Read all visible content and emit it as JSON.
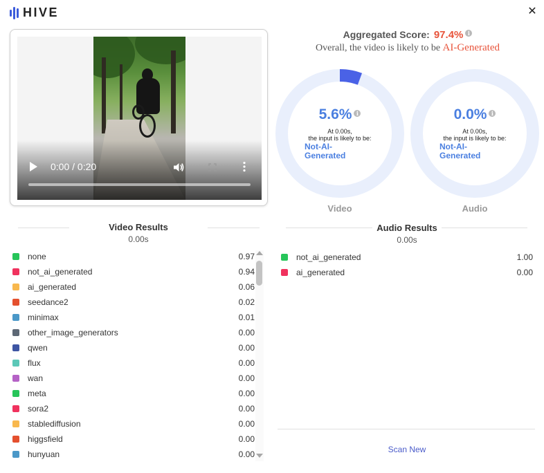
{
  "app": {
    "logo_text": "HIVE",
    "brand_color": "#3b5bdb",
    "icons": {
      "close": "close-icon",
      "info": "info-icon"
    }
  },
  "video_player": {
    "time": "0:00 / 0:20",
    "progress": 0.0,
    "icons": {
      "play": "play-icon",
      "volume": "volume-icon",
      "fullscreen": "fullscreen-icon",
      "more": "more-vert-icon"
    }
  },
  "aggregate": {
    "label": "Aggregated Score:",
    "score": "97.4%",
    "summary_prefix": "Overall, the video is likely to be",
    "verdict": "AI-Generated",
    "verdict_color": "#e8543b",
    "info_glyph": "i"
  },
  "rings": [
    {
      "key": "video",
      "value_text": "5.6%",
      "fraction": 0.056,
      "time_line": "At 0.00s,",
      "likely_line": "the input is likely to be:",
      "verdict_line1": "Not-AI-",
      "verdict_line2": "Generated",
      "caption": "Video",
      "info_glyph": "i"
    },
    {
      "key": "audio",
      "value_text": "0.0%",
      "fraction": 0.0,
      "time_line": "At 0.00s,",
      "likely_line": "the input is likely to be:",
      "verdict_line1": "Not-AI-",
      "verdict_line2": "Generated",
      "caption": "Audio",
      "info_glyph": "i"
    }
  ],
  "ring_colors": {
    "track": "#e9effc",
    "fill": "#4a62e6",
    "text": "#4a7fe0"
  },
  "video_results": {
    "title": "Video Results",
    "time": "0.00s",
    "items": [
      {
        "name": "none",
        "value": "0.97",
        "color": "#27c55a"
      },
      {
        "name": "not_ai_generated",
        "value": "0.94",
        "color": "#f0325e"
      },
      {
        "name": "ai_generated",
        "value": "0.06",
        "color": "#f8b84e"
      },
      {
        "name": "seedance2",
        "value": "0.02",
        "color": "#e4502e"
      },
      {
        "name": "minimax",
        "value": "0.01",
        "color": "#4b98c8"
      },
      {
        "name": "other_image_generators",
        "value": "0.00",
        "color": "#5d6875"
      },
      {
        "name": "qwen",
        "value": "0.00",
        "color": "#3e55a3"
      },
      {
        "name": "flux",
        "value": "0.00",
        "color": "#5cc8b8"
      },
      {
        "name": "wan",
        "value": "0.00",
        "color": "#b562c6"
      },
      {
        "name": "meta",
        "value": "0.00",
        "color": "#27c55a"
      },
      {
        "name": "sora2",
        "value": "0.00",
        "color": "#f0325e"
      },
      {
        "name": "stablediffusion",
        "value": "0.00",
        "color": "#f8b84e"
      },
      {
        "name": "higgsfield",
        "value": "0.00",
        "color": "#e4502e"
      },
      {
        "name": "hunyuan",
        "value": "0.00",
        "color": "#4b98c8"
      }
    ]
  },
  "audio_results": {
    "title": "Audio Results",
    "time": "0.00s",
    "items": [
      {
        "name": "not_ai_generated",
        "value": "1.00",
        "color": "#27c55a"
      },
      {
        "name": "ai_generated",
        "value": "0.00",
        "color": "#f0325e"
      }
    ]
  },
  "actions": {
    "scan_new": "Scan New"
  }
}
